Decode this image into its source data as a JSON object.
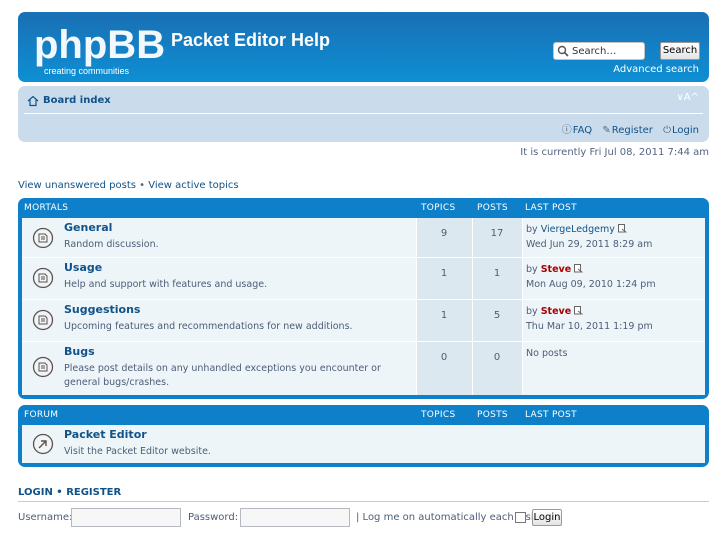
{
  "header": {
    "logo_text": "phpBB",
    "logo_tagline": "creating communities",
    "site_title": "Packet Editor Help",
    "search_placeholder": "Search…",
    "search_button": "Search",
    "advanced_search": "Advanced search"
  },
  "nav": {
    "board_index": "Board index",
    "font_size": "∨A^",
    "faq": "FAQ",
    "register": "Register",
    "login": "Login"
  },
  "current_time": "It is currently Fri Jul 08, 2011 7:44 am",
  "quick_links": {
    "unanswered": "View unanswered posts",
    "sep": " • ",
    "active": "View active topics"
  },
  "categories": [
    {
      "title": "MORTALS",
      "col_topics": "TOPICS",
      "col_posts": "POSTS",
      "col_last": "LAST POST",
      "forums": [
        {
          "name": "General",
          "desc": "Random discussion.",
          "topics": "9",
          "posts": "17",
          "last_by": "by ",
          "last_user": "ViergeLedgemy",
          "last_user_red": false,
          "last_date": "Wed Jun 29, 2011 8:29 am"
        },
        {
          "name": "Usage",
          "desc": "Help and support with features and usage.",
          "topics": "1",
          "posts": "1",
          "last_by": "by ",
          "last_user": "Steve",
          "last_user_red": true,
          "last_date": "Mon Aug 09, 2010 1:24 pm"
        },
        {
          "name": "Suggestions",
          "desc": "Upcoming features and recommendations for new additions.",
          "topics": "1",
          "posts": "5",
          "last_by": "by ",
          "last_user": "Steve",
          "last_user_red": true,
          "last_date": "Thu Mar 10, 2011 1:19 pm"
        },
        {
          "name": "Bugs",
          "desc": "Please post details on any unhandled exceptions you encounter or general bugs/crashes.",
          "topics": "0",
          "posts": "0",
          "last_by": "No posts",
          "last_user": "",
          "last_user_red": false,
          "last_date": ""
        }
      ]
    },
    {
      "title": "FORUM",
      "col_topics": "TOPICS",
      "col_posts": "POSTS",
      "col_last": "LAST POST",
      "forums": [
        {
          "name": "Packet Editor",
          "desc": "Visit the Packet Editor website.",
          "link": true
        }
      ]
    }
  ],
  "login": {
    "title_login": "LOGIN",
    "title_sep": " • ",
    "title_register": "REGISTER",
    "username_label": "Username:",
    "password_label": "Password:",
    "auto_label": "| Log me on automatically each visit",
    "login_button": "Login"
  },
  "colors": {
    "header_blue": "#1a6fb4",
    "category_blue": "#0e80c9",
    "navbar": "#cadceb",
    "link": "#105289",
    "moderator_red": "#aa0000"
  }
}
